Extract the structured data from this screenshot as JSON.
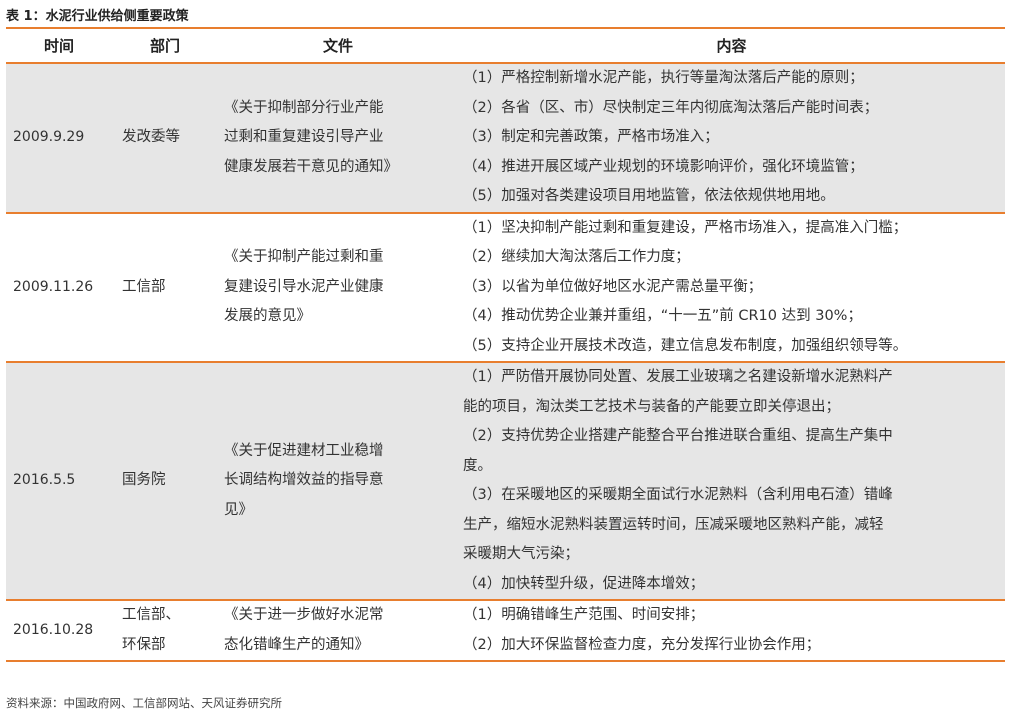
{
  "caption": "表 1：水泥行业供给侧重要政策",
  "headers": [
    "时间",
    "部门",
    "文件",
    "内容"
  ],
  "rows": [
    {
      "time": "2009.9.29",
      "dept": [
        "发改委等"
      ],
      "doc": [
        "《关于抑制部分行业产能",
        "过剩和重复建设引导产业",
        "健康发展若干意见的通知》"
      ],
      "content": [
        "（1）严格控制新增水泥产能，执行等量淘汰落后产能的原则；",
        "（2）各省（区、市）尽快制定三年内彻底淘汰落后产能时间表；",
        "（3）制定和完善政策，严格市场准入；",
        "（4）推进开展区域产业规划的环境影响评价，强化环境监管；",
        "（5）加强对各类建设项目用地监管，依法依规供地用地。"
      ]
    },
    {
      "time": "2009.11.26",
      "dept": [
        "工信部"
      ],
      "doc": [
        "《关于抑制产能过剩和重",
        "复建设引导水泥产业健康",
        "发展的意见》"
      ],
      "content": [
        "（1）坚决抑制产能过剩和重复建设，严格市场准入，提高准入门槛；",
        "（2）继续加大淘汰落后工作力度；",
        "（3）以省为单位做好地区水泥产需总量平衡；",
        "（4）推动优势企业兼并重组，“十一五”前 CR10 达到 30%；",
        "（5）支持企业开展技术改造，建立信息发布制度，加强组织领导等。"
      ]
    },
    {
      "time": "2016.5.5",
      "dept": [
        "国务院"
      ],
      "doc": [
        "《关于促进建材工业稳增",
        "长调结构增效益的指导意",
        "见》"
      ],
      "content": [
        "（1）严防借开展协同处置、发展工业玻璃之名建设新增水泥熟料产",
        "能的项目，淘汰类工艺技术与装备的产能要立即关停退出；",
        "（2）支持优势企业搭建产能整合平台推进联合重组、提高生产集中",
        "度。",
        "（3）在采暖地区的采暖期全面试行水泥熟料（含利用电石渣）错峰",
        "生产，缩短水泥熟料装置运转时间，压减采暖地区熟料产能，减轻",
        "采暖期大气污染；",
        "（4）加快转型升级，促进降本增效；"
      ]
    },
    {
      "time": "2016.10.28",
      "dept": [
        "工信部、",
        "环保部"
      ],
      "doc": [
        "《关于进一步做好水泥常",
        "态化错峰生产的通知》"
      ],
      "content": [
        "（1）明确错峰生产范围、时间安排；",
        "（2）加大环保监督检查力度，充分发挥行业协会作用；"
      ]
    }
  ],
  "source": "资料来源：中国政府网、工信部网站、天风证券研究所",
  "colors": {
    "accent": "#e87e2e",
    "shade": "#e6e6e6"
  }
}
